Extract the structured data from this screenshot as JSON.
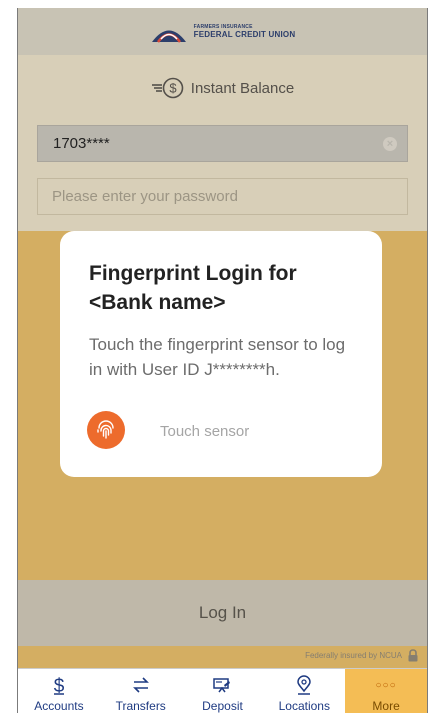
{
  "header": {
    "logo_small": "FARMERS INSURANCE",
    "logo_big": "FEDERAL CREDIT UNION"
  },
  "instant_balance": {
    "label": "Instant Balance",
    "icon": "instant-balance-dollar-icon"
  },
  "login": {
    "user_id_value": "1703****",
    "password_placeholder": "Please enter your password",
    "login_button": "Log In",
    "ncua_text": "Federally insured by NCUA"
  },
  "dialog": {
    "title": "Fingerprint Login for <Bank name>",
    "description": "Touch the fingerprint sensor to log in with User ID J********h.",
    "sensor_label": "Touch sensor",
    "sensor_icon": "fingerprint-icon"
  },
  "tabs": [
    {
      "label": "Accounts",
      "icon": "dollar-icon"
    },
    {
      "label": "Transfers",
      "icon": "transfer-arrows-icon"
    },
    {
      "label": "Deposit",
      "icon": "check-deposit-icon"
    },
    {
      "label": "Locations",
      "icon": "location-pin-icon"
    },
    {
      "label": "More",
      "icon": "more-dots-icon"
    }
  ],
  "colors": {
    "accent": "#f4bd55",
    "brand_blue": "#1f3b82",
    "fingerprint_orange": "#ed6b2c",
    "overlay": "#d4ae62"
  }
}
